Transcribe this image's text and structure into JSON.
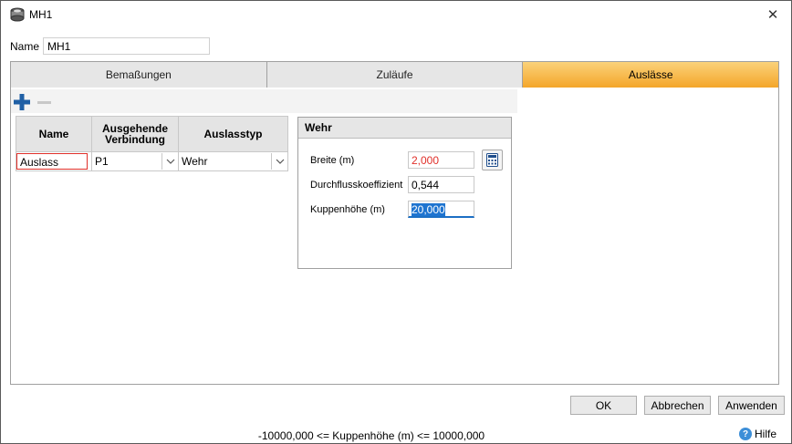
{
  "window": {
    "title": "MH1",
    "close_glyph": "✕"
  },
  "name_field": {
    "label": "Name",
    "value": "MH1"
  },
  "tabs": [
    {
      "label": "Bemaßungen",
      "active": false
    },
    {
      "label": "Zuläufe",
      "active": false
    },
    {
      "label": "Auslässe",
      "active": true
    }
  ],
  "grid": {
    "headers": {
      "name": "Name",
      "outgoing": "Ausgehende Verbindung",
      "type": "Auslasstyp"
    },
    "rows": [
      {
        "name": "Auslass",
        "outgoing": "P1",
        "type": "Wehr"
      }
    ]
  },
  "panel": {
    "title": "Wehr",
    "fields": [
      {
        "label": "Breite (m)",
        "value": "2,000"
      },
      {
        "label": "Durchflusskoeffizient",
        "value": "0,544"
      },
      {
        "label": "Kuppenhöhe (m)",
        "value": "20,000"
      }
    ]
  },
  "buttons": {
    "ok": "OK",
    "cancel": "Abbrechen",
    "apply": "Anwenden"
  },
  "status_text": "-10000,000 <= Kuppenhöhe (m) <= 10000,000",
  "help_label": "Hilfe",
  "colors": {
    "active_tab": "#f4a62a",
    "invalid_border": "#e0302a",
    "accent": "#1e74d0",
    "add_icon": "#1f5fa5"
  }
}
